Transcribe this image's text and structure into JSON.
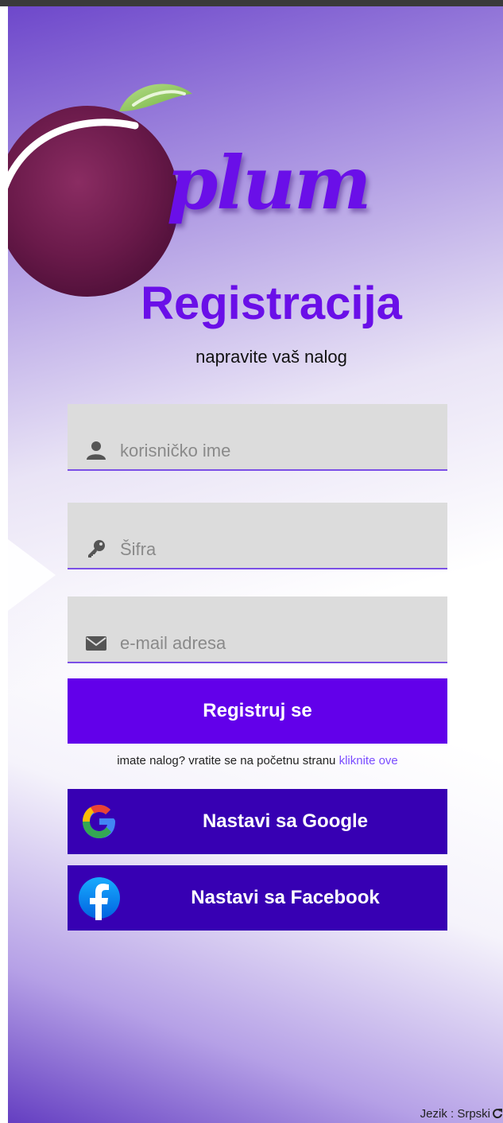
{
  "brand": {
    "logo_text": "plum"
  },
  "header": {
    "title": "Registracija",
    "subtitle": "napravite vaš nalog"
  },
  "form": {
    "username": {
      "placeholder": "korisničko ime",
      "value": "",
      "icon": "user-icon"
    },
    "password": {
      "placeholder": "Šifra",
      "value": "",
      "icon": "key-icon"
    },
    "email": {
      "placeholder": "e-mail adresa",
      "value": "",
      "icon": "envelope-icon"
    },
    "submit_label": "Registruj se"
  },
  "login_hint": {
    "text": "imate nalog? vratite se na početnu stranu",
    "link_text": "kliknite ove"
  },
  "social": {
    "google_label": "Nastavi sa Google",
    "facebook_label": "Nastavi sa Facebook"
  },
  "footer": {
    "language_label": "Jezik : Srpski",
    "icon": "refresh-icon"
  },
  "colors": {
    "primary": "#6200ea",
    "social": "#3700b3",
    "title": "#6a0fe8",
    "link": "#7a4dff",
    "field_bg": "#dcdcdc"
  }
}
